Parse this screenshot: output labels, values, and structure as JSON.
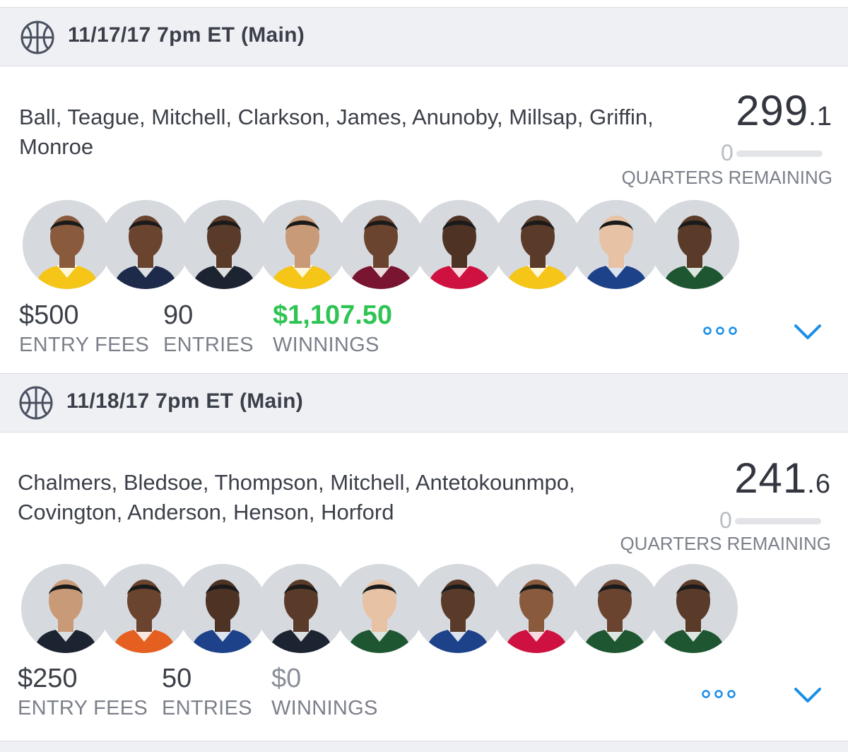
{
  "contests": [
    {
      "title": "11/17/17 7pm ET (Main)",
      "lineup": "Ball, Teague, Mitchell, Clarkson, James, Anunoby, Millsap, Griffin, Monroe",
      "score_int": "299",
      "score_dec": ".1",
      "quarters_remaining": "0",
      "quarters_label": "QUARTERS REMAINING",
      "player_jerseys": [
        "#f5c518",
        "#1d2a4a",
        "#1c2331",
        "#f5c518",
        "#7a1531",
        "#ce1141",
        "#f5c518",
        "#1d428a",
        "#1e5631"
      ],
      "entry_fees": "$500",
      "entry_fees_label": "ENTRY FEES",
      "entries": "90",
      "entries_label": "ENTRIES",
      "winnings": "$1,107.50",
      "winnings_label": "WINNINGS",
      "winnings_color": "#2fc453"
    },
    {
      "title": "11/18/17 7pm ET (Main)",
      "lineup": "Chalmers, Bledsoe, Thompson, Mitchell, Antetokounmpo, Covington, Anderson, Henson, Horford",
      "score_int": "241",
      "score_dec": ".6",
      "quarters_remaining": "0",
      "quarters_label": "QUARTERS REMAINING",
      "player_jerseys": [
        "#1c2331",
        "#e56020",
        "#1d428a",
        "#1c2331",
        "#1e5631",
        "#1d428a",
        "#ce1141",
        "#1e5631",
        "#1e5631"
      ],
      "entry_fees": "$250",
      "entry_fees_label": "ENTRY FEES",
      "entries": "50",
      "entries_label": "ENTRIES",
      "winnings": "$0",
      "winnings_label": "WINNINGS",
      "winnings_color": "#8b8f99"
    }
  ],
  "colors": {
    "accent": "#1a8fe8",
    "header_bg": "#eff0f4",
    "positive": "#2fc453"
  },
  "icons": {
    "sport": "basketball-icon",
    "more": "more-options-icon",
    "expand": "chevron-down-icon"
  }
}
